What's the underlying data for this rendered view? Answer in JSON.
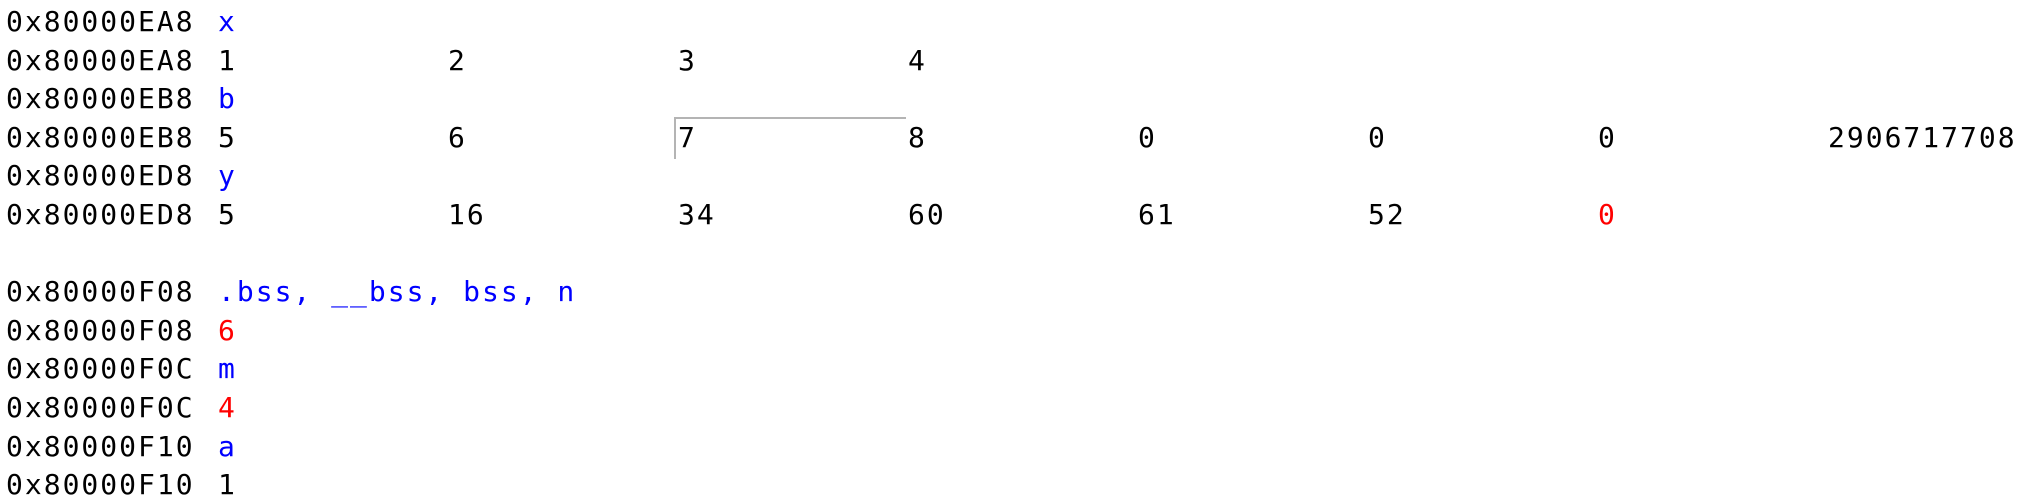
{
  "colors": {
    "label": "#0000ff",
    "value": "#000000",
    "changed": "#ff0000"
  },
  "rows": [
    {
      "address": "0x80000EA8",
      "kind": "label",
      "cells": [
        {
          "text": "x",
          "state": "label"
        }
      ]
    },
    {
      "address": "0x80000EA8",
      "kind": "values",
      "cells": [
        {
          "text": "1",
          "state": "val"
        },
        {
          "text": "2",
          "state": "val"
        },
        {
          "text": "3",
          "state": "val"
        },
        {
          "text": "4",
          "state": "val"
        }
      ]
    },
    {
      "address": "0x80000EB8",
      "kind": "label",
      "cells": [
        {
          "text": "b",
          "state": "label"
        }
      ]
    },
    {
      "address": "0x80000EB8",
      "kind": "values",
      "cells": [
        {
          "text": "5",
          "state": "val"
        },
        {
          "text": "6",
          "state": "val"
        },
        {
          "text": "7",
          "state": "val",
          "selected": true
        },
        {
          "text": "8",
          "state": "val"
        },
        {
          "text": "0",
          "state": "val"
        },
        {
          "text": "0",
          "state": "val"
        },
        {
          "text": "0",
          "state": "val"
        },
        {
          "text": "2906717708",
          "state": "val"
        }
      ]
    },
    {
      "address": "0x80000ED8",
      "kind": "label",
      "cells": [
        {
          "text": "y",
          "state": "label"
        }
      ]
    },
    {
      "address": "0x80000ED8",
      "kind": "values",
      "cells": [
        {
          "text": "5",
          "state": "val"
        },
        {
          "text": "16",
          "state": "val"
        },
        {
          "text": "34",
          "state": "val"
        },
        {
          "text": "60",
          "state": "val"
        },
        {
          "text": "61",
          "state": "val"
        },
        {
          "text": "52",
          "state": "val"
        },
        {
          "text": "0",
          "state": "changed"
        }
      ]
    },
    {
      "address": "",
      "kind": "blank",
      "cells": []
    },
    {
      "address": "0x80000F08",
      "kind": "label",
      "cells": [
        {
          "text": ".bss, __bss, bss, n",
          "state": "label"
        }
      ]
    },
    {
      "address": "0x80000F08",
      "kind": "values",
      "cells": [
        {
          "text": "6",
          "state": "changed"
        }
      ]
    },
    {
      "address": "0x80000F0C",
      "kind": "label",
      "cells": [
        {
          "text": "m",
          "state": "label"
        }
      ]
    },
    {
      "address": "0x80000F0C",
      "kind": "values",
      "cells": [
        {
          "text": "4",
          "state": "changed"
        }
      ]
    },
    {
      "address": "0x80000F10",
      "kind": "label",
      "cells": [
        {
          "text": "a",
          "state": "label"
        }
      ]
    },
    {
      "address": "0x80000F10",
      "kind": "values",
      "cells": [
        {
          "text": "1",
          "state": "val"
        }
      ]
    }
  ]
}
